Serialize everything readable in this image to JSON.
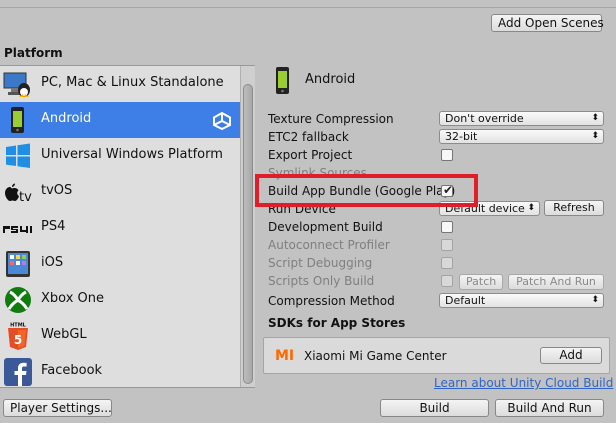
{
  "toolbar": {
    "add_open_scenes": "Add Open Scenes"
  },
  "platform_header": "Platform",
  "platforms": [
    {
      "label": "PC, Mac & Linux Standalone",
      "icon": "pc-mac-linux-icon",
      "selected": false
    },
    {
      "label": "Android",
      "icon": "android-phone-icon",
      "selected": true,
      "badge_icon": "unity-logo-icon"
    },
    {
      "label": "Universal Windows Platform",
      "icon": "windows-logo-icon",
      "selected": false
    },
    {
      "label": "tvOS",
      "icon": "apple-tv-icon",
      "selected": false
    },
    {
      "label": "PS4",
      "icon": "ps4-logo-icon",
      "selected": false
    },
    {
      "label": "iOS",
      "icon": "ipad-icon",
      "selected": false
    },
    {
      "label": "Xbox One",
      "icon": "xbox-logo-icon",
      "selected": false
    },
    {
      "label": "WebGL",
      "icon": "html5-logo-icon",
      "selected": false,
      "icon_text": "HTML"
    },
    {
      "label": "Facebook",
      "icon": "facebook-logo-icon",
      "selected": false
    }
  ],
  "settings": {
    "title": "Android",
    "texture_compression": {
      "label": "Texture Compression",
      "value": "Don't override"
    },
    "etc2_fallback": {
      "label": "ETC2 fallback",
      "value": "32-bit"
    },
    "export_project": {
      "label": "Export Project",
      "checked": false
    },
    "symlink_sources": {
      "label": "Symlink Sources",
      "checked": false
    },
    "build_app_bundle": {
      "label": "Build App Bundle (Google Play)",
      "checked": true
    },
    "run_device": {
      "label": "Run Device",
      "value": "Default device",
      "refresh": "Refresh"
    },
    "development_build": {
      "label": "Development Build",
      "checked": false
    },
    "autoconnect_profiler": {
      "label": "Autoconnect Profiler",
      "checked": false
    },
    "script_debugging": {
      "label": "Script Debugging",
      "checked": false
    },
    "scripts_only_build": {
      "label": "Scripts Only Build",
      "checked": false,
      "patch": "Patch",
      "patch_and_run": "Patch And Run"
    },
    "compression_method": {
      "label": "Compression Method",
      "value": "Default"
    }
  },
  "sdks": {
    "header": "SDKs for App Stores",
    "items": [
      {
        "logo": "mi",
        "name": "Xiaomi Mi Game Center",
        "action": "Add"
      }
    ]
  },
  "cloud_link": "Learn about Unity Cloud Build",
  "footer": {
    "player_settings": "Player Settings...",
    "build": "Build",
    "build_and_run": "Build And Run"
  },
  "colors": {
    "selection": "#3d7fe6",
    "highlight_box": "#e01e2a",
    "link": "#2f65c8",
    "mi_orange": "#ff6a00"
  }
}
